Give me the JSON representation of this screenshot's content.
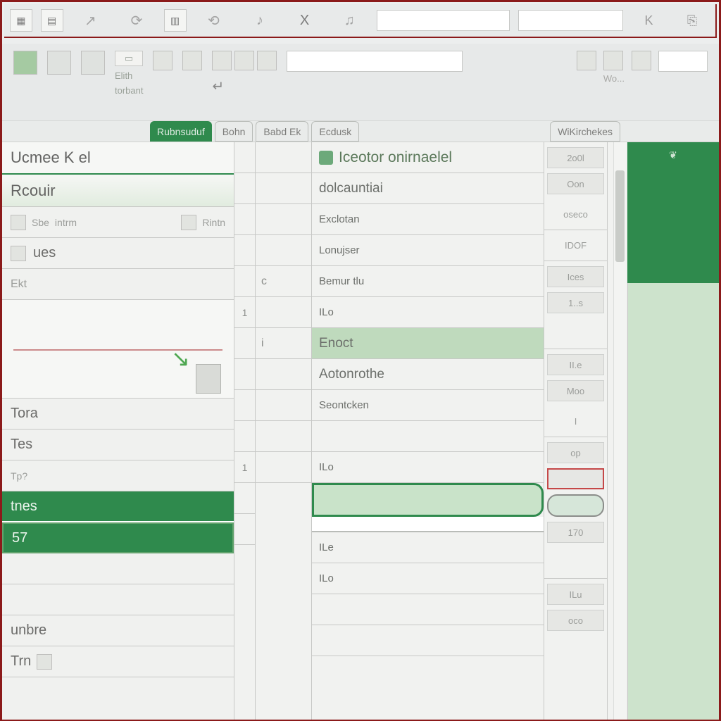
{
  "top_toolbar": {
    "btn1": "▦",
    "sym1": "↗",
    "sym2": "⟳",
    "sym3": "⟲",
    "sym4": "♪",
    "x": "X",
    "sym5": "♫",
    "k": "K",
    "end": "⎘"
  },
  "ribbon": {
    "lbl1": "Elith",
    "lbl2": "torbant",
    "badge": "Wo..."
  },
  "col_headers": [
    "Rubnsuduf",
    "Bohn",
    "Babd Ek",
    "Ecdusk",
    "WiKirchekes"
  ],
  "left": {
    "header": "Ucmee K el",
    "sub": "Rcouir",
    "row_sbe": "Sbe",
    "row_intrm": "intrm",
    "row_rintn": "Rintn",
    "row_ues": "ues",
    "row_tora": "Tora",
    "row_tes": "Tes",
    "row_tpen": "Tp?",
    "row_tnes": "tnes",
    "row_57": "57",
    "row_unbre": "unbre",
    "row_trn": "Trn"
  },
  "grid": {
    "rownums": [
      "",
      "",
      "",
      "",
      "",
      "1",
      "",
      "",
      "",
      "",
      "1",
      "",
      "",
      "",
      "",
      "",
      "",
      "",
      ""
    ],
    "colA": [
      "",
      "",
      "",
      "",
      "c",
      "",
      "i",
      "",
      "",
      "",
      "",
      "",
      "",
      "",
      "",
      "",
      "",
      "",
      ""
    ],
    "colB": {
      "title": "Iceotor onirnaelel",
      "r1": "dolcauntiai",
      "r2": "Exclotan",
      "r3": "Lonujser",
      "r4": "Bemur tlu",
      "r5": "ILo",
      "r6": "Enoct",
      "r7": "Aotonrothe",
      "r8": "Seontcken",
      "r9": "",
      "r10": "ILo",
      "r11": "",
      "r12": "",
      "r13": "ILe",
      "r14": "ILo",
      "r15": "",
      "r16": ""
    },
    "colC": {
      "v0": "2o0l",
      "v1": "Oon",
      "v2": "oseco",
      "v3": "IDOF",
      "v4": "Ices",
      "v5": "1..s",
      "v6": "",
      "v7": "II.e",
      "v8": "Moo",
      "v9": "I",
      "v10": "op",
      "v11": "",
      "v12": "",
      "v13": "170",
      "v14": "",
      "v15": "ILu",
      "v16": "oco"
    }
  }
}
